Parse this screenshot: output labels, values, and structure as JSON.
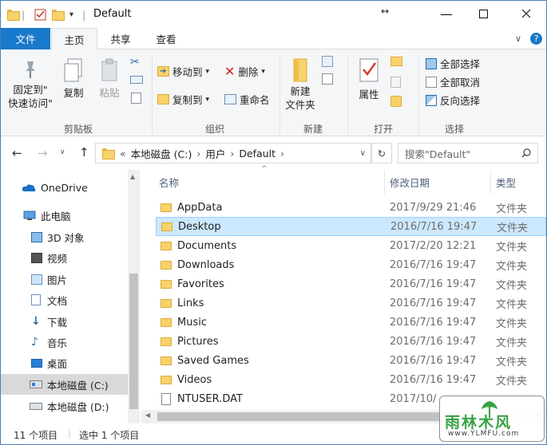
{
  "window": {
    "title": "Default",
    "minimize_icon": "minimize-icon",
    "maximize_icon": "maximize-icon",
    "close_icon": "close-icon"
  },
  "tabs": {
    "file": "文件",
    "home": "主页",
    "share": "共享",
    "view": "查看"
  },
  "ribbon": {
    "pin_label_1": "固定到\"",
    "pin_label_2": "快速访问\"",
    "copy": "复制",
    "paste": "粘贴",
    "clipboard_group": "剪贴板",
    "move_to": "移动到",
    "copy_to": "复制到",
    "delete": "删除",
    "rename": "重命名",
    "organize_group": "组织",
    "new_folder_1": "新建",
    "new_folder_2": "文件夹",
    "new_group": "新建",
    "properties": "属性",
    "open_group": "打开",
    "select_all": "全部选择",
    "select_none": "全部取消",
    "invert_selection": "反向选择",
    "select_group": "选择"
  },
  "address": {
    "breadcrumb_prefix": "«",
    "crumbs": [
      "本地磁盘 (C:)",
      "用户",
      "Default"
    ],
    "search_placeholder": "搜索\"Default\""
  },
  "nav": {
    "items": [
      "OneDrive",
      "此电脑",
      "3D 对象",
      "视频",
      "图片",
      "文档",
      "下载",
      "音乐",
      "桌面",
      "本地磁盘 (C:)",
      "本地磁盘 (D:)"
    ]
  },
  "columns": {
    "name": "名称",
    "date": "修改日期",
    "type": "类型"
  },
  "files": [
    {
      "name": "AppData",
      "date": "2017/9/29 21:46",
      "type": "文件夹"
    },
    {
      "name": "Desktop",
      "date": "2016/7/16 19:47",
      "type": "文件夹"
    },
    {
      "name": "Documents",
      "date": "2017/2/20 12:21",
      "type": "文件夹"
    },
    {
      "name": "Downloads",
      "date": "2016/7/16 19:47",
      "type": "文件夹"
    },
    {
      "name": "Favorites",
      "date": "2016/7/16 19:47",
      "type": "文件夹"
    },
    {
      "name": "Links",
      "date": "2016/7/16 19:47",
      "type": "文件夹"
    },
    {
      "name": "Music",
      "date": "2016/7/16 19:47",
      "type": "文件夹"
    },
    {
      "name": "Pictures",
      "date": "2016/7/16 19:47",
      "type": "文件夹"
    },
    {
      "name": "Saved Games",
      "date": "2016/7/16 19:47",
      "type": "文件夹"
    },
    {
      "name": "Videos",
      "date": "2016/7/16 19:47",
      "type": "文件夹"
    },
    {
      "name": "NTUSER.DAT",
      "date": "2017/10/",
      "type": ""
    }
  ],
  "status": {
    "count": "11 个项目",
    "selected": "选中 1 个项目"
  },
  "watermark": {
    "text": "雨林木风",
    "url": "www.YLMFU.com"
  },
  "colors": {
    "accent": "#1979ca",
    "selection": "#cce8ff",
    "folder": "#f8d26a"
  }
}
